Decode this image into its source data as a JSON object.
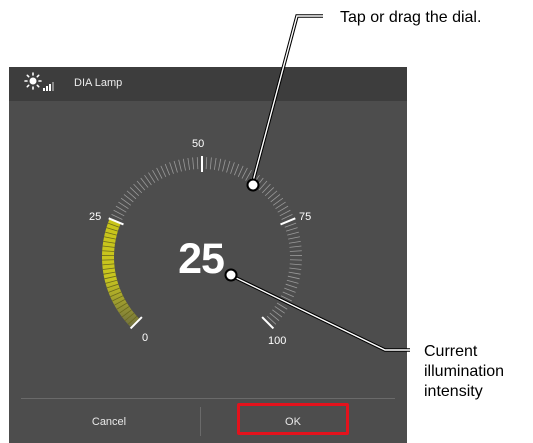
{
  "dialog": {
    "title": "DIA Lamp",
    "icon": "lamp-brightness-icon",
    "value": "25",
    "value_number": 25,
    "scale_max": 100,
    "tick_labels": {
      "t0": "0",
      "t25": "25",
      "t50": "50",
      "t75": "75",
      "t100": "100"
    },
    "fill_color": "#d4d11a",
    "cancel_label": "Cancel",
    "ok_label": "OK",
    "highlight_color": "#e3121c"
  },
  "callouts": {
    "dial": "Tap or drag the dial.",
    "intensity_line1": "Current",
    "intensity_line2": "illumination",
    "intensity_line3": "intensity"
  }
}
